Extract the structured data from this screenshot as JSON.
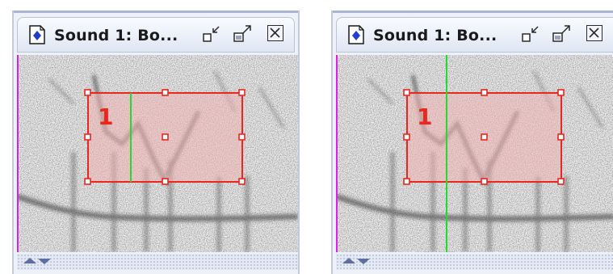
{
  "windows": [
    {
      "title": "Sound 1: Bo...",
      "selection_label": "1",
      "cursor_fraction": 0.28
    },
    {
      "title": "Sound 1: Bo...",
      "selection_label": "1",
      "cursor_fraction": 0.25
    }
  ],
  "icons": {
    "doc": "document-diamond-icon",
    "minimize": "minimize-icon",
    "maximize": "maximize-icon",
    "close": "close-icon",
    "scroll": "scroll-arrows-icon"
  },
  "colors": {
    "selection_border": "#e8281f",
    "selection_fill": "#f2b2b2",
    "cursor_line": "#2ad53a",
    "edge_marker": "#e020e0",
    "icon_blue": "#1f3fd0"
  }
}
